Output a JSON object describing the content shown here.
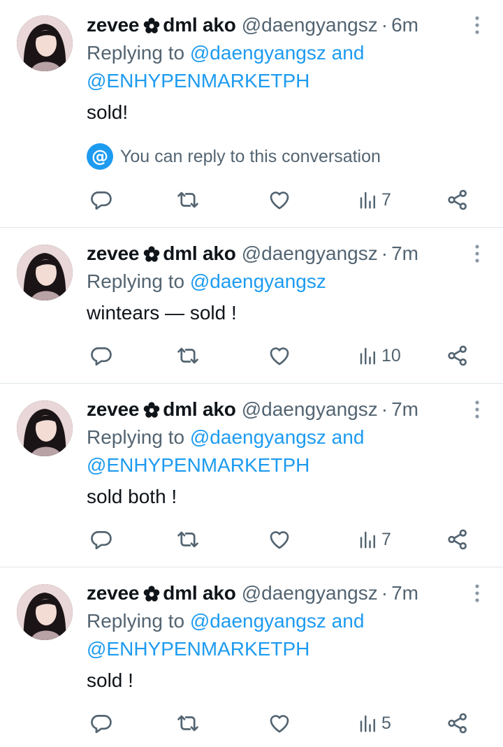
{
  "tweets": [
    {
      "name": "zevee",
      "name_suffix": "dml ako",
      "handle": "@daengyangsz",
      "time": "6m",
      "replying_prefix": "Replying to",
      "mentions": [
        "@daengyangsz",
        "and",
        "@ENHYPENMARKETPH"
      ],
      "text": "sold!",
      "notice": "You can reply to this conversation",
      "views": "7"
    },
    {
      "name": "zevee",
      "name_suffix": "dml ako",
      "handle": "@daengyangsz",
      "time": "7m",
      "replying_prefix": "Replying to",
      "mentions": [
        "@daengyangsz"
      ],
      "text": "wintears — sold !",
      "views": "10"
    },
    {
      "name": "zevee",
      "name_suffix": "dml ako",
      "handle": "@daengyangsz",
      "time": "7m",
      "replying_prefix": "Replying to",
      "mentions": [
        "@daengyangsz",
        "and",
        "@ENHYPENMARKETPH"
      ],
      "text": "sold both !",
      "views": "7"
    },
    {
      "name": "zevee",
      "name_suffix": "dml ako",
      "handle": "@daengyangsz",
      "time": "7m",
      "replying_prefix": "Replying to",
      "mentions": [
        "@daengyangsz",
        "and",
        "@ENHYPENMARKETPH"
      ],
      "text": "sold !",
      "views": "5"
    }
  ],
  "icons": {
    "flower": "flower-icon",
    "more": "more-vertical-icon",
    "reply": "reply-icon",
    "retweet": "retweet-icon",
    "like": "heart-icon",
    "views": "views-chart-icon",
    "share": "share-icon",
    "notice": "at-sign-icon"
  },
  "colors": {
    "link": "#1d9bf0",
    "secondary_text": "#536471",
    "primary_text": "#0f1419",
    "divider": "#e1e5e9"
  }
}
